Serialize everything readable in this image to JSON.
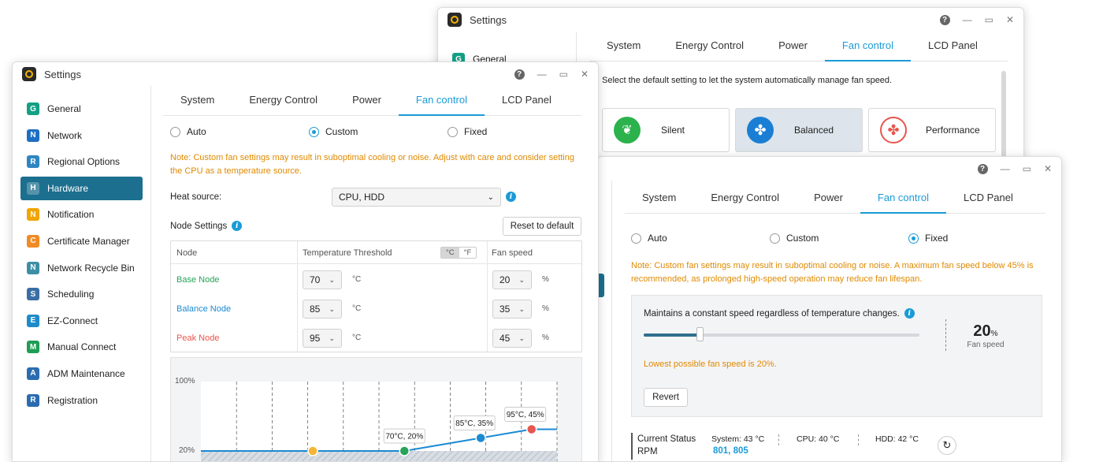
{
  "window_back": {
    "title": "Settings",
    "sidebar_first": "General",
    "tabs": [
      "System",
      "Energy Control",
      "Power",
      "Fan control",
      "LCD Panel"
    ],
    "active_tab": 3,
    "description": "Select the default setting to let the system automatically manage fan speed.",
    "modes": [
      {
        "label": "Silent",
        "icon": "leaf-icon",
        "color": "#2bb24c"
      },
      {
        "label": "Balanced",
        "icon": "fan-icon",
        "color": "#1a7fd4"
      },
      {
        "label": "Performance",
        "icon": "fan-red-icon",
        "color": "#e8554e"
      }
    ]
  },
  "window_front": {
    "title": "Settings",
    "sidebar": [
      {
        "label": "General",
        "icon": "general-icon",
        "color": "#14a085"
      },
      {
        "label": "Network",
        "icon": "globe-icon",
        "color": "#1d6fc4"
      },
      {
        "label": "Regional Options",
        "icon": "region-icon",
        "color": "#2e86c1"
      },
      {
        "label": "Hardware",
        "icon": "hardware-icon",
        "color": "#1c6f8f"
      },
      {
        "label": "Notification",
        "icon": "notification-icon",
        "color": "#f0a500"
      },
      {
        "label": "Certificate Manager",
        "icon": "certificate-icon",
        "color": "#f08a24"
      },
      {
        "label": "Network Recycle Bin",
        "icon": "recycle-icon",
        "color": "#3c8fa6"
      },
      {
        "label": "Scheduling",
        "icon": "calendar-icon",
        "color": "#3a6ea5"
      },
      {
        "label": "EZ-Connect",
        "icon": "cloud-icon",
        "color": "#1d8bc9"
      },
      {
        "label": "Manual Connect",
        "icon": "connect-icon",
        "color": "#1f9d55"
      },
      {
        "label": "ADM Maintenance",
        "icon": "maintenance-icon",
        "color": "#2b6cb0"
      },
      {
        "label": "Registration",
        "icon": "registration-icon",
        "color": "#2b6cb0"
      }
    ],
    "active_sidebar": 3,
    "tabs": [
      "System",
      "Energy Control",
      "Power",
      "Fan control",
      "LCD Panel"
    ],
    "active_tab": 3,
    "radios": [
      "Auto",
      "Custom",
      "Fixed"
    ],
    "selected_radio": 1,
    "note": "Note: Custom fan settings may result in suboptimal cooling or noise. Adjust with care and consider setting the CPU as a temperature source.",
    "heat_source_label": "Heat source:",
    "heat_source_value": "CPU, HDD",
    "node_settings_label": "Node Settings",
    "reset_label": "Reset to default",
    "table_headers": {
      "node": "Node",
      "threshold": "Temperature Threshold",
      "unit_c": "°C",
      "unit_f": "°F",
      "fan": "Fan speed"
    },
    "nodes": [
      {
        "name": "Base Node",
        "temp": "70",
        "temp_unit": "°C",
        "speed": "20",
        "speed_unit": "%",
        "color": "#27a35a"
      },
      {
        "name": "Balance Node",
        "temp": "85",
        "temp_unit": "°C",
        "speed": "35",
        "speed_unit": "%",
        "color": "#1a8ad4"
      },
      {
        "name": "Peak Node",
        "temp": "95",
        "temp_unit": "°C",
        "speed": "45",
        "speed_unit": "%",
        "color": "#e8554e"
      }
    ],
    "chart": {
      "y_labels": [
        "100%",
        "20%"
      ],
      "point_labels": [
        "70°C, 20%",
        "85°C, 35%",
        "95°C, 45%"
      ]
    }
  },
  "window_right": {
    "tabs": [
      "System",
      "Energy Control",
      "Power",
      "Fan control",
      "LCD Panel"
    ],
    "active_tab": 3,
    "radios": [
      "Auto",
      "Custom",
      "Fixed"
    ],
    "selected_radio": 2,
    "note": "Note: Custom fan settings may result in suboptimal cooling or noise. A maximum fan speed below 45% is recommended, as prolonged high-speed operation may reduce fan lifespan.",
    "constant_text": "Maintains a constant speed regardless of temperature changes.",
    "slider_value": 0.2,
    "speed_number": "20",
    "speed_unit": "%",
    "speed_caption": "Fan speed",
    "lowest_text": "Lowest possible fan speed is 20%.",
    "revert_label": "Revert",
    "status_label": "Current Status",
    "rpm_label": "RPM",
    "system_temp": "System: 43 °C",
    "cpu_temp": "CPU: 40 °C",
    "hdd_temp": "HDD: 42 °C",
    "rpm_value": "801, 805"
  }
}
